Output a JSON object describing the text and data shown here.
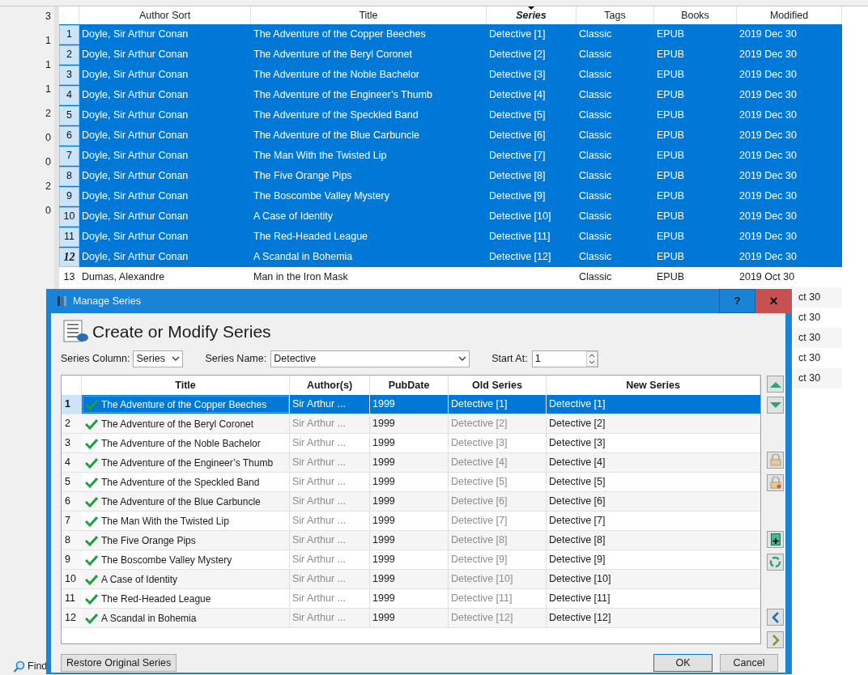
{
  "side_counts": [
    "3",
    "1",
    "1",
    "1",
    "2",
    "0",
    "0",
    "2",
    "0"
  ],
  "library": {
    "columns": [
      {
        "label": "Author Sort",
        "sorted": false
      },
      {
        "label": "Title",
        "sorted": false
      },
      {
        "label": "Series",
        "sorted": true
      },
      {
        "label": "Tags",
        "sorted": false
      },
      {
        "label": "Books",
        "sorted": false
      },
      {
        "label": "Modified",
        "sorted": false
      }
    ],
    "rows": [
      {
        "number": "1",
        "selected": true,
        "current": false,
        "cells": [
          "Doyle, Sir Arthur Conan",
          "The Adventure of the Copper Beeches",
          "Detective [1]",
          "Classic",
          "EPUB",
          "2019 Dec 30"
        ]
      },
      {
        "number": "2",
        "selected": true,
        "current": false,
        "cells": [
          "Doyle, Sir Arthur Conan",
          "The Adventure of the Beryl Coronet",
          "Detective [2]",
          "Classic",
          "EPUB",
          "2019 Dec 30"
        ]
      },
      {
        "number": "3",
        "selected": true,
        "current": false,
        "cells": [
          "Doyle, Sir Arthur Conan",
          "The Adventure of the Noble Bachelor",
          "Detective [3]",
          "Classic",
          "EPUB",
          "2019 Dec 30"
        ]
      },
      {
        "number": "4",
        "selected": true,
        "current": false,
        "cells": [
          "Doyle, Sir Arthur Conan",
          "The Adventure of the Engineer’s Thumb",
          "Detective [4]",
          "Classic",
          "EPUB",
          "2019 Dec 30"
        ]
      },
      {
        "number": "5",
        "selected": true,
        "current": false,
        "cells": [
          "Doyle, Sir Arthur Conan",
          "The Adventure of the Speckled Band",
          "Detective [5]",
          "Classic",
          "EPUB",
          "2019 Dec 30"
        ]
      },
      {
        "number": "6",
        "selected": true,
        "current": false,
        "cells": [
          "Doyle, Sir Arthur Conan",
          "The Adventure of the Blue Carbuncle",
          "Detective [6]",
          "Classic",
          "EPUB",
          "2019 Dec 30"
        ]
      },
      {
        "number": "7",
        "selected": true,
        "current": false,
        "cells": [
          "Doyle, Sir Arthur Conan",
          "The Man With the Twisted Lip",
          "Detective [7]",
          "Classic",
          "EPUB",
          "2019 Dec 30"
        ]
      },
      {
        "number": "8",
        "selected": true,
        "current": false,
        "cells": [
          "Doyle, Sir Arthur Conan",
          "The Five Orange Pips",
          "Detective [8]",
          "Classic",
          "EPUB",
          "2019 Dec 30"
        ]
      },
      {
        "number": "9",
        "selected": true,
        "current": false,
        "cells": [
          "Doyle, Sir Arthur Conan",
          "The Boscombe Valley Mystery",
          "Detective [9]",
          "Classic",
          "EPUB",
          "2019 Dec 30"
        ]
      },
      {
        "number": "10",
        "selected": true,
        "current": false,
        "cells": [
          "Doyle, Sir Arthur Conan",
          "A Case of Identity",
          "Detective [10]",
          "Classic",
          "EPUB",
          "2019 Dec 30"
        ]
      },
      {
        "number": "11",
        "selected": true,
        "current": false,
        "cells": [
          "Doyle, Sir Arthur Conan",
          "The Red-Headed League",
          "Detective [11]",
          "Classic",
          "EPUB",
          "2019 Dec 30"
        ]
      },
      {
        "number": "12",
        "selected": true,
        "current": true,
        "cells": [
          "Doyle, Sir Arthur Conan",
          "A Scandal in Bohemia",
          "Detective [12]",
          "Classic",
          "EPUB",
          "2019 Dec 30"
        ]
      },
      {
        "number": "13",
        "selected": false,
        "current": false,
        "cells": [
          "Dumas, Alexandre",
          "Man in the Iron Mask",
          "",
          "Classic",
          "EPUB",
          "2019 Oct 30"
        ]
      }
    ],
    "rows_behind_dialog": [
      {
        "modified": "ct 30"
      },
      {
        "modified": "ct 30"
      },
      {
        "modified": "ct 30"
      },
      {
        "modified": "ct 30"
      },
      {
        "modified": "ct 30"
      }
    ]
  },
  "find": "Find",
  "dialog": {
    "title": "Manage Series",
    "help": "?",
    "close": "×",
    "heading": "Create or Modify Series",
    "series_column": {
      "label": "Series Column:",
      "value": "Series"
    },
    "series_name": {
      "label": "Series Name:",
      "value": "Detective"
    },
    "start_at": {
      "label": "Start At:",
      "value": "1"
    },
    "columns": [
      "Title",
      "Author(s)",
      "PubDate",
      "Old Series",
      "New Series"
    ],
    "rows": [
      {
        "number": "1",
        "selected": true,
        "checked": true,
        "title": "The Adventure of the Copper Beeches",
        "authors": "Sir Arthur ...",
        "pubdate": "1999",
        "old_series": "Detective [1]",
        "new_series": "Detective [1]"
      },
      {
        "number": "2",
        "selected": false,
        "checked": true,
        "title": "The Adventure of the Beryl Coronet",
        "authors": "Sir Arthur ...",
        "pubdate": "1999",
        "old_series": "Detective [2]",
        "new_series": "Detective [2]"
      },
      {
        "number": "3",
        "selected": false,
        "checked": true,
        "title": "The Adventure of the Noble Bachelor",
        "authors": "Sir Arthur ...",
        "pubdate": "1999",
        "old_series": "Detective [3]",
        "new_series": "Detective [3]"
      },
      {
        "number": "4",
        "selected": false,
        "checked": true,
        "title": "The Adventure of the Engineer’s Thumb",
        "authors": "Sir Arthur ...",
        "pubdate": "1999",
        "old_series": "Detective [4]",
        "new_series": "Detective [4]"
      },
      {
        "number": "5",
        "selected": false,
        "checked": true,
        "title": "The Adventure of the Speckled Band",
        "authors": "Sir Arthur ...",
        "pubdate": "1999",
        "old_series": "Detective [5]",
        "new_series": "Detective [5]"
      },
      {
        "number": "6",
        "selected": false,
        "checked": true,
        "title": "The Adventure of the Blue Carbuncle",
        "authors": "Sir Arthur ...",
        "pubdate": "1999",
        "old_series": "Detective [6]",
        "new_series": "Detective [6]"
      },
      {
        "number": "7",
        "selected": false,
        "checked": true,
        "title": "The Man With the Twisted Lip",
        "authors": "Sir Arthur ...",
        "pubdate": "1999",
        "old_series": "Detective [7]",
        "new_series": "Detective [7]"
      },
      {
        "number": "8",
        "selected": false,
        "checked": true,
        "title": "The Five Orange Pips",
        "authors": "Sir Arthur ...",
        "pubdate": "1999",
        "old_series": "Detective [8]",
        "new_series": "Detective [8]"
      },
      {
        "number": "9",
        "selected": false,
        "checked": true,
        "title": "The Boscombe Valley Mystery",
        "authors": "Sir Arthur ...",
        "pubdate": "1999",
        "old_series": "Detective [9]",
        "new_series": "Detective [9]"
      },
      {
        "number": "10",
        "selected": false,
        "checked": true,
        "title": "A Case of Identity",
        "authors": "Sir Arthur ...",
        "pubdate": "1999",
        "old_series": "Detective [10]",
        "new_series": "Detective [10]"
      },
      {
        "number": "11",
        "selected": false,
        "checked": true,
        "title": "The Red-Headed League",
        "authors": "Sir Arthur ...",
        "pubdate": "1999",
        "old_series": "Detective [11]",
        "new_series": "Detective [11]"
      },
      {
        "number": "12",
        "selected": false,
        "checked": true,
        "title": "A Scandal in Bohemia",
        "authors": "Sir Arthur ...",
        "pubdate": "1999",
        "old_series": "Detective [12]",
        "new_series": "Detective [12]"
      }
    ],
    "buttons": {
      "restore": "Restore Original Series",
      "ok": "OK",
      "cancel": "Cancel"
    }
  }
}
